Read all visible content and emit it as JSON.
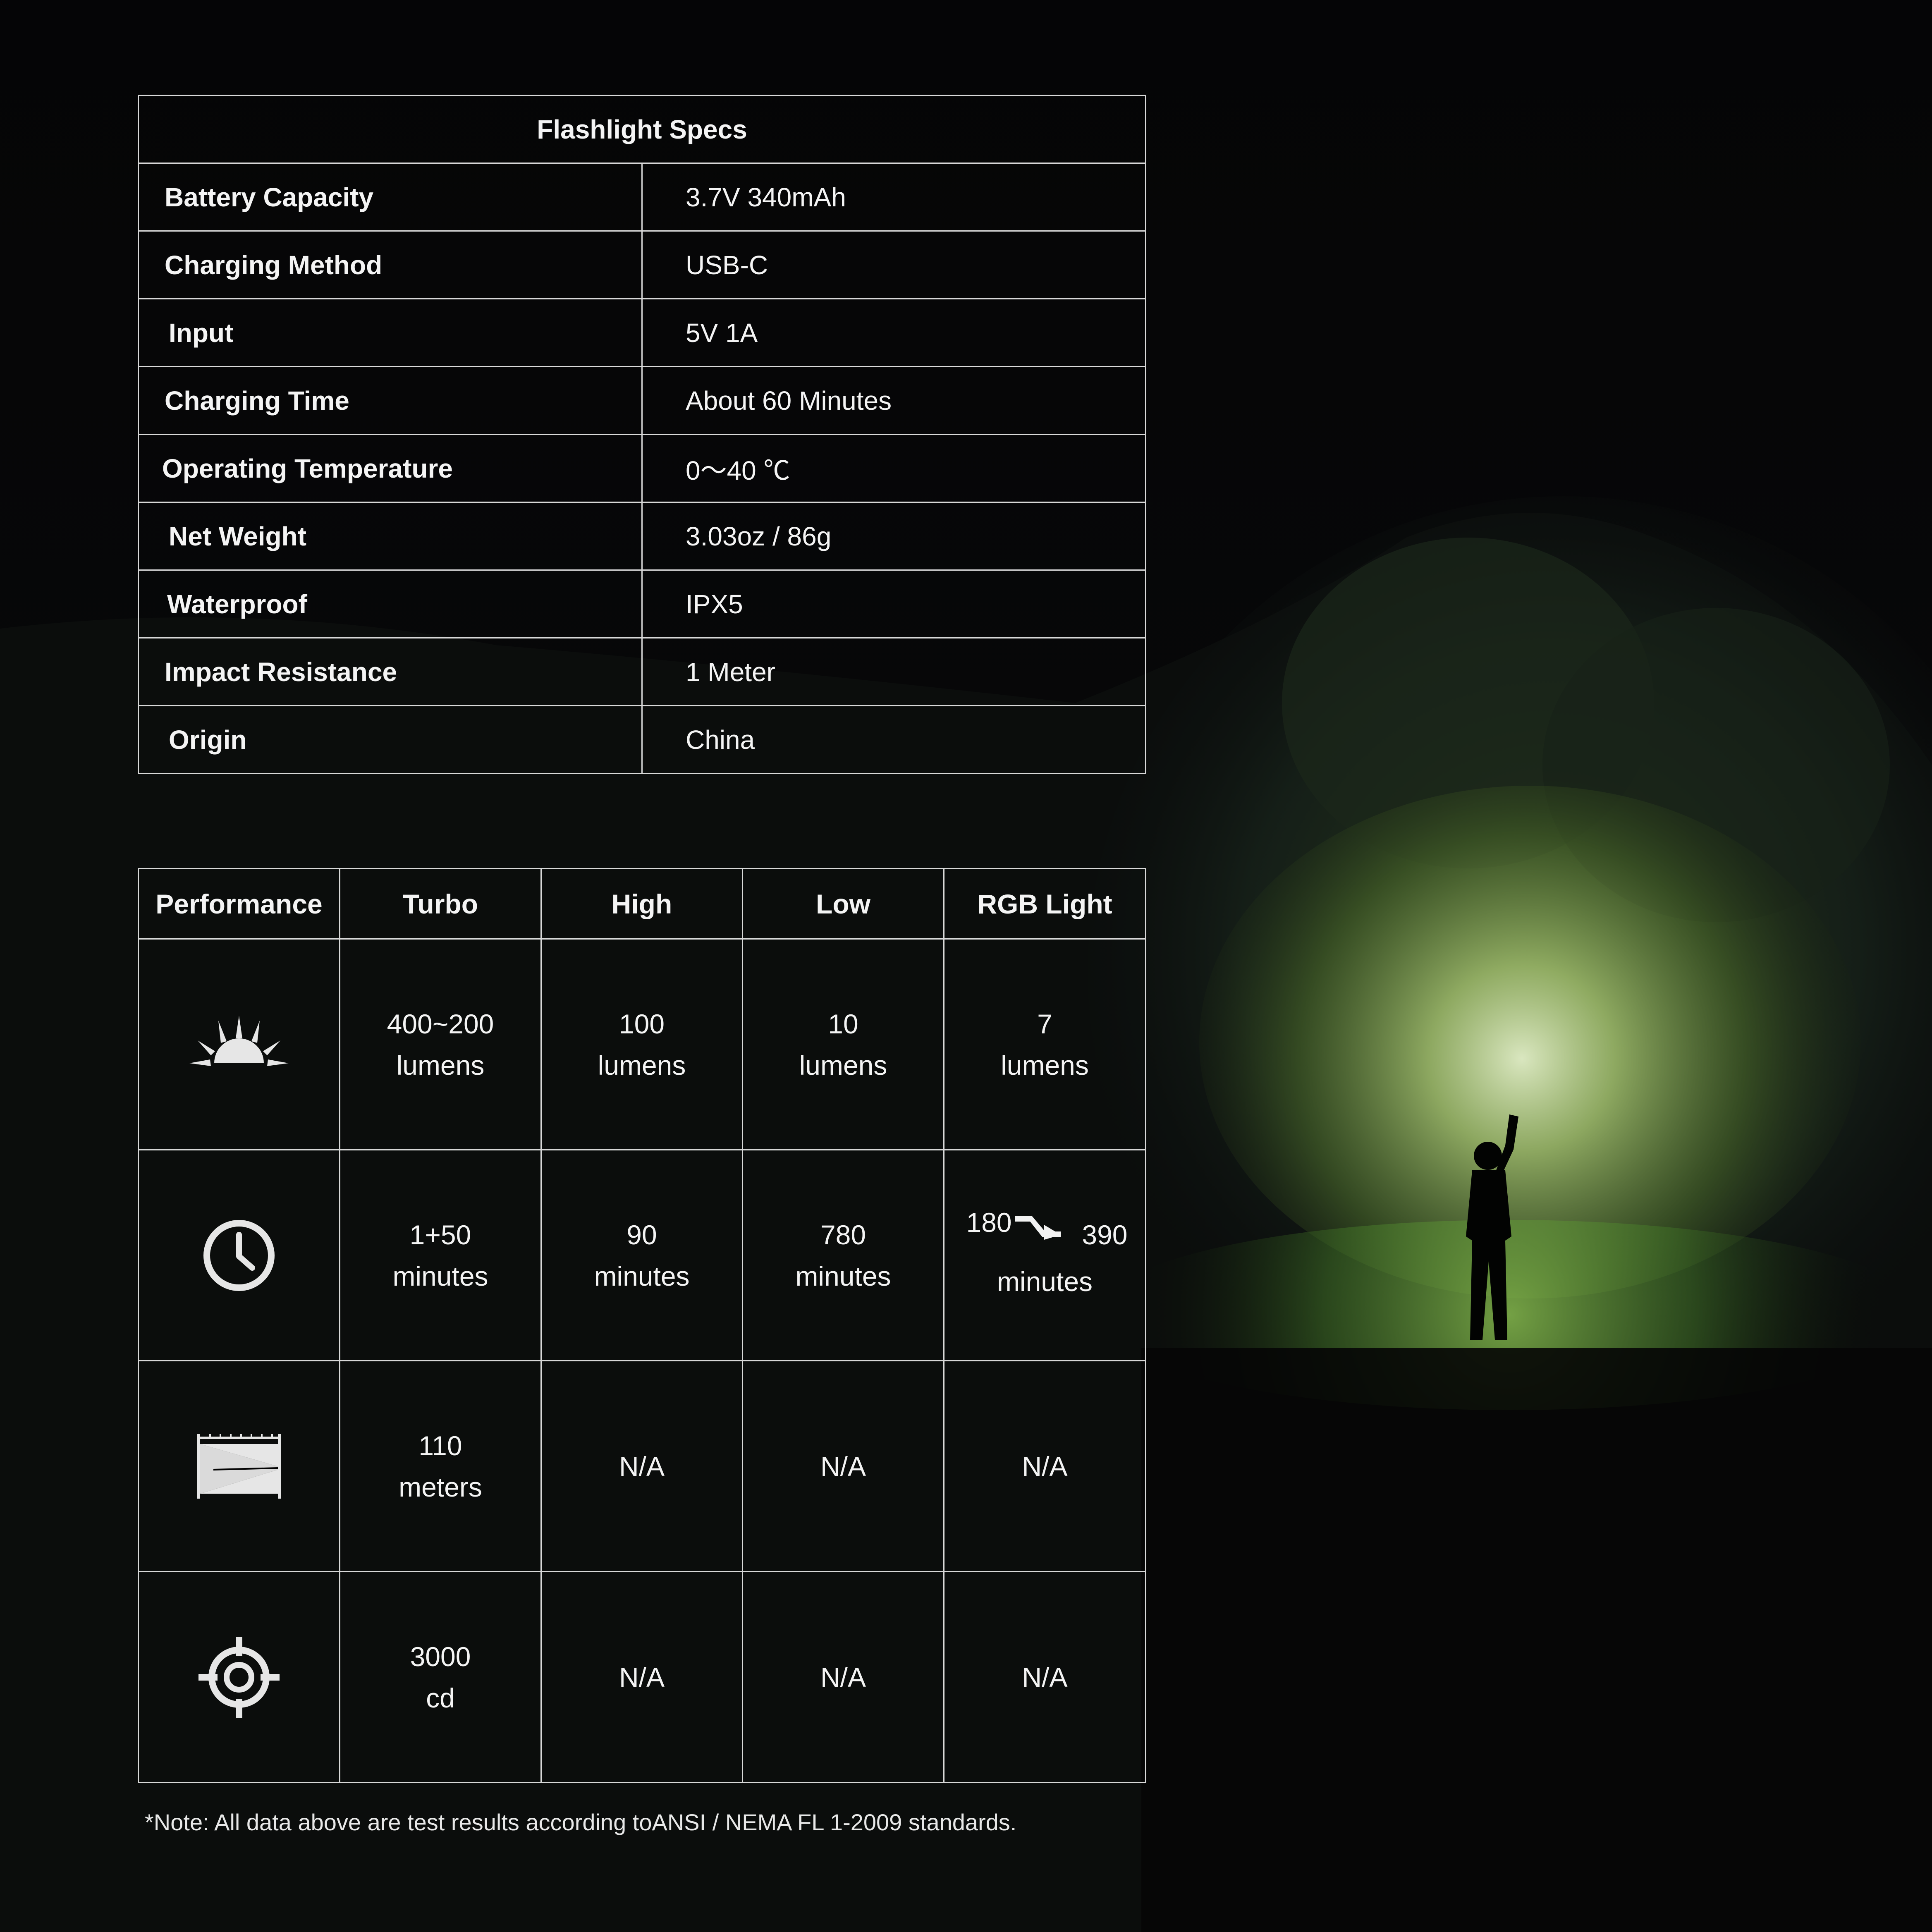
{
  "spec_table": {
    "title": "Flashlight Specs",
    "rows": [
      {
        "label": "Battery Capacity",
        "value": "3.7V 340mAh"
      },
      {
        "label": "Charging Method",
        "value": "USB-C"
      },
      {
        "label": "Input",
        "value": "5V 1A"
      },
      {
        "label": "Charging Time",
        "value": "About 60 Minutes"
      },
      {
        "label": "Operating Temperature",
        "value": "0～40 ℃"
      },
      {
        "label": "Net Weight",
        "value": "3.03oz / 86g"
      },
      {
        "label": "Waterproof",
        "value": "IPX5"
      },
      {
        "label": "Impact Resistance",
        "value": "1 Meter"
      },
      {
        "label": "Origin",
        "value": "China"
      }
    ]
  },
  "performance_table": {
    "headers": [
      "Performance",
      "Turbo",
      "High",
      "Low",
      "RGB Light"
    ],
    "rows": [
      {
        "icon": "brightness-icon",
        "cells": [
          [
            "400~200",
            "lumens"
          ],
          [
            "100",
            "lumens"
          ],
          [
            "10",
            "lumens"
          ],
          [
            "7",
            "lumens"
          ]
        ]
      },
      {
        "icon": "clock-icon",
        "cells": [
          [
            "1+50",
            "minutes"
          ],
          [
            "90",
            "minutes"
          ],
          [
            "780",
            "minutes"
          ]
        ],
        "rgb_runtime": {
          "from": "180",
          "to": "390",
          "unit": "minutes"
        }
      },
      {
        "icon": "beam-distance-icon",
        "cells": [
          [
            "110",
            "meters"
          ],
          [
            "N/A"
          ],
          [
            "N/A"
          ],
          [
            "N/A"
          ]
        ]
      },
      {
        "icon": "target-icon",
        "cells": [
          [
            "3000",
            "cd"
          ],
          [
            "N/A"
          ],
          [
            "N/A"
          ],
          [
            "N/A"
          ]
        ]
      }
    ]
  },
  "note": "*Note: All data above are test results according toANSI / NEMA FL 1-2009 standards.",
  "colors": {
    "background": "#030303",
    "grid_lines": "#d8d8d8",
    "text": "#f4f4f4",
    "foliage_lit": "#9fbf63"
  }
}
